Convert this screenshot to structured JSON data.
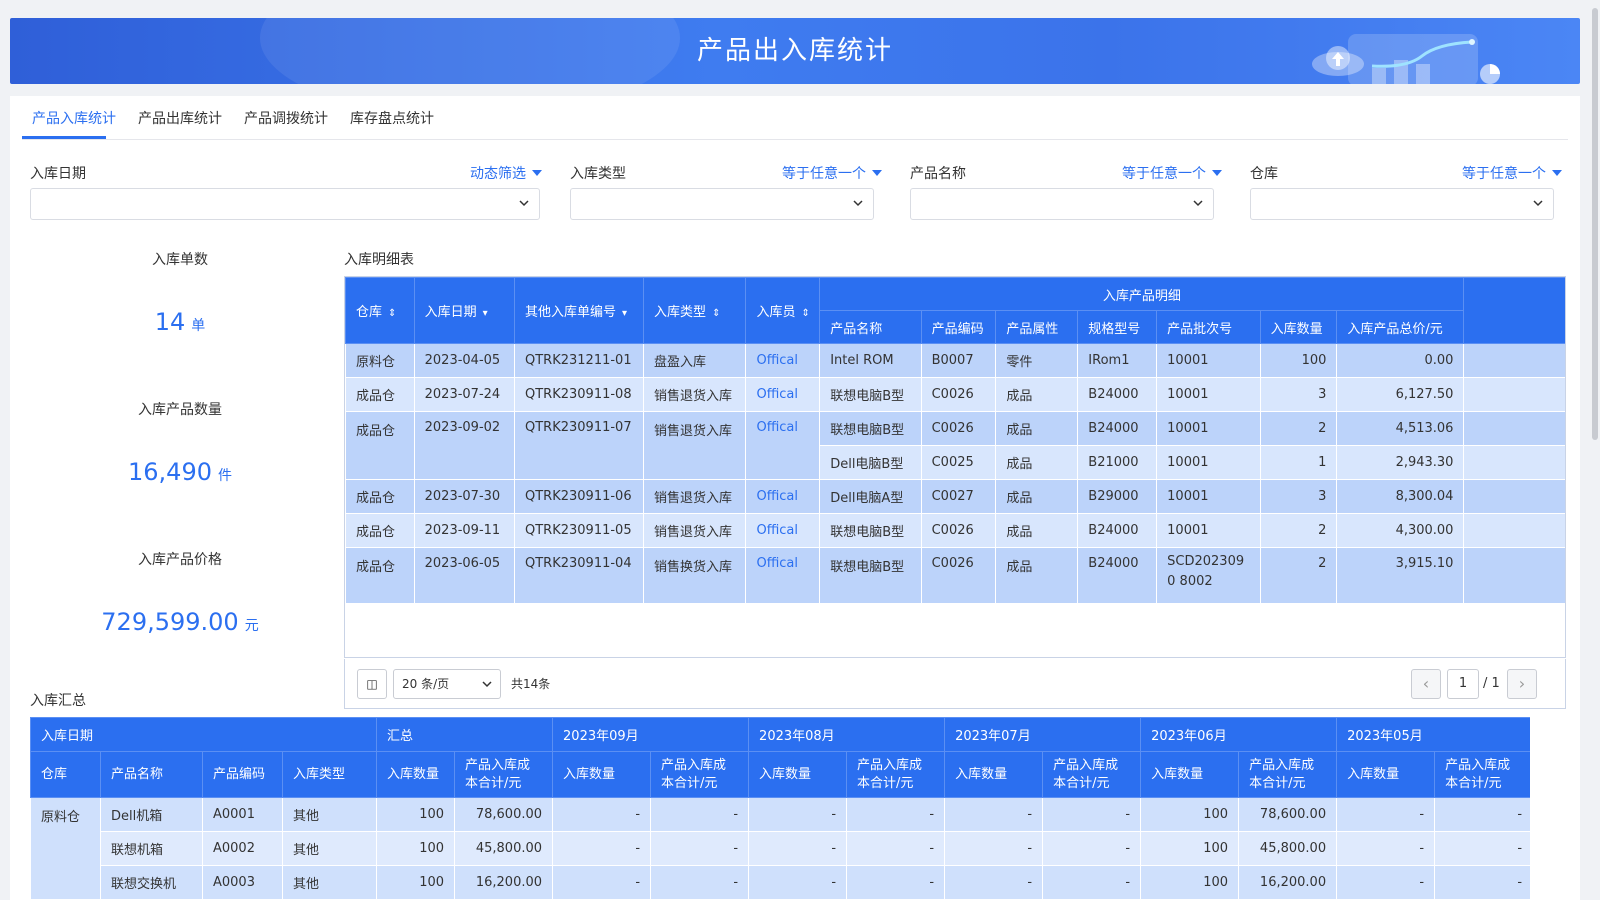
{
  "banner": {
    "title": "产品出入库统计"
  },
  "tabs": [
    "产品入库统计",
    "产品出库统计",
    "产品调拨统计",
    "库存盘点统计"
  ],
  "filters": [
    {
      "label": "入库日期",
      "mode": "动态筛选"
    },
    {
      "label": "入库类型",
      "mode": "等于任意一个"
    },
    {
      "label": "产品名称",
      "mode": "等于任意一个"
    },
    {
      "label": "仓库",
      "mode": "等于任意一个"
    }
  ],
  "kpis": [
    {
      "label": "入库单数",
      "value": "14",
      "unit": "单"
    },
    {
      "label": "入库产品数量",
      "value": "16,490",
      "unit": "件"
    },
    {
      "label": "入库产品价格",
      "value": "729,599.00",
      "unit": "元"
    }
  ],
  "detail": {
    "title": "入库明细表",
    "group_header": "入库产品明细",
    "columns": [
      "仓库",
      "入库日期",
      "其他入库单编号",
      "入库类型",
      "入库员",
      "产品名称",
      "产品编码",
      "产品属性",
      "规格型号",
      "产品批次号",
      "入库数量",
      "入库产品总价/元"
    ],
    "rows": [
      [
        "原料仓",
        "2023-04-05",
        "QTRK231211-01",
        "盘盈入库",
        "Offical",
        "Intel ROM",
        "B0007",
        "零件",
        "IRom1",
        "10001",
        "100",
        "0.00"
      ],
      [
        "成品仓",
        "2023-07-24",
        "QTRK230911-08",
        "销售退货入库",
        "Offical",
        "联想电脑B型",
        "C0026",
        "成品",
        "B24000",
        "10001",
        "3",
        "6,127.50"
      ],
      [
        "成品仓",
        "2023-09-02",
        "QTRK230911-07",
        "销售退货入库",
        "Offical",
        "联想电脑B型",
        "C0026",
        "成品",
        "B24000",
        "10001",
        "2",
        "4,513.06"
      ],
      [
        "",
        "",
        "",
        "",
        "",
        "Dell电脑B型",
        "C0025",
        "成品",
        "B21000",
        "10001",
        "1",
        "2,943.30"
      ],
      [
        "成品仓",
        "2023-07-30",
        "QTRK230911-06",
        "销售退货入库",
        "Offical",
        "Dell电脑A型",
        "C0027",
        "成品",
        "B29000",
        "10001",
        "3",
        "8,300.04"
      ],
      [
        "成品仓",
        "2023-09-11",
        "QTRK230911-05",
        "销售退货入库",
        "Offical",
        "联想电脑B型",
        "C0026",
        "成品",
        "B24000",
        "10001",
        "2",
        "4,300.00"
      ],
      [
        "成品仓",
        "2023-06-05",
        "QTRK230911-04",
        "销售换货入库",
        "Offical",
        "联想电脑B型",
        "C0026",
        "成品",
        "B24000",
        "SCD2023090 8002",
        "2",
        "3,915.10"
      ]
    ]
  },
  "pager": {
    "page_size": "20 条/页",
    "total": "共14条",
    "current": "1",
    "pages": "/ 1"
  },
  "summary": {
    "title": "入库汇总",
    "date_header": "入库日期",
    "total_header": "汇总",
    "months": [
      "2023年09月",
      "2023年08月",
      "2023年07月",
      "2023年06月",
      "2023年05月"
    ],
    "dim_headers": [
      "仓库",
      "产品名称",
      "产品编码",
      "入库类型"
    ],
    "qty_header": "入库数量",
    "cost_header": "产品入库成本合计/元",
    "rows": [
      [
        "原料仓",
        "Dell机箱",
        "A0001",
        "其他",
        "100",
        "78,600.00",
        "-",
        "-",
        "-",
        "-",
        "-",
        "-",
        "100",
        "78,600.00",
        "-",
        "-"
      ],
      [
        "",
        "联想机箱",
        "A0002",
        "其他",
        "100",
        "45,800.00",
        "-",
        "-",
        "-",
        "-",
        "-",
        "-",
        "100",
        "45,800.00",
        "-",
        "-"
      ],
      [
        "",
        "联想交换机",
        "A0003",
        "其他",
        "100",
        "16,200.00",
        "-",
        "-",
        "-",
        "-",
        "-",
        "-",
        "100",
        "16,200.00",
        "-",
        "-"
      ]
    ]
  },
  "colors": {
    "accent": "#2b6ff0",
    "row_blue": "#bcd3fa",
    "row_light": "#d8e6fd"
  }
}
